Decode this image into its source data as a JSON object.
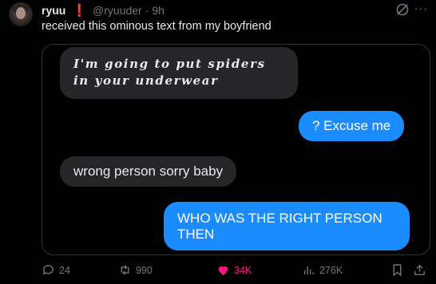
{
  "post": {
    "display_name": "ryuu",
    "badge": "❗",
    "handle": "@ryuuder",
    "separator": "·",
    "time": "9h",
    "text": "received this ominous text from my boyfriend"
  },
  "messages": [
    {
      "from": "incoming",
      "text": "I'm going to put spiders in your underwear"
    },
    {
      "from": "outgoing",
      "text": "? Excuse me"
    },
    {
      "from": "incoming",
      "text": "wrong person sorry baby"
    },
    {
      "from": "outgoing",
      "text": "WHO WAS THE RIGHT PERSON THEN"
    }
  ],
  "actions": {
    "replies": "24",
    "reposts": "990",
    "likes": "34K",
    "views": "276K"
  },
  "icons": {
    "reply": "reply-icon",
    "repost": "repost-icon",
    "like": "heart-icon",
    "views": "views-icon",
    "bookmark": "bookmark-icon",
    "share": "share-icon",
    "grok": "grok-icon",
    "more": "more-icon"
  },
  "colors": {
    "background": "#000000",
    "incoming_bubble": "#262628",
    "outgoing_bubble": "#1a8cff",
    "like": "#f91880",
    "muted": "#71767b"
  }
}
